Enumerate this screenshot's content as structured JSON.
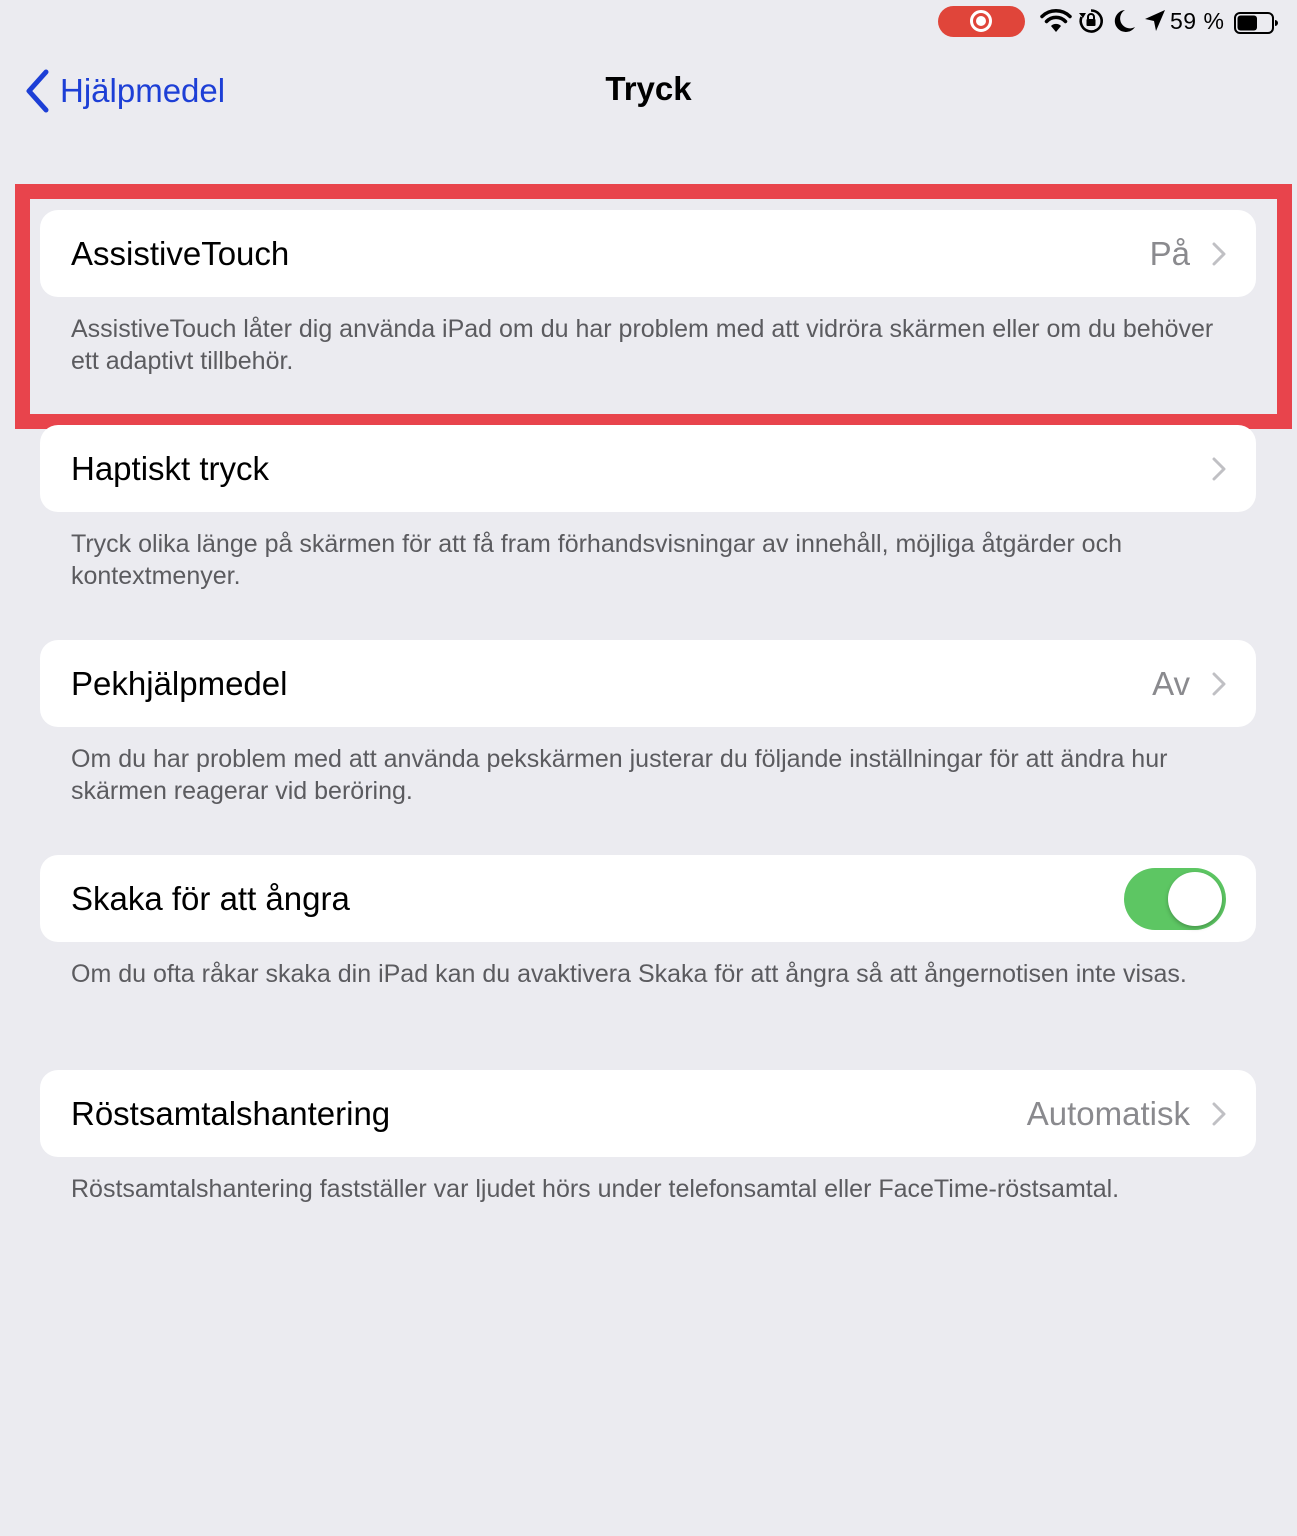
{
  "status_bar": {
    "battery_percent": "59 %",
    "battery_level": 0.59,
    "icons": [
      "screen-record-icon",
      "wifi-icon",
      "rotation-lock-icon",
      "moon-icon",
      "location-arrow-icon",
      "battery-icon"
    ],
    "record_color": "#e0453a"
  },
  "nav": {
    "back_label": "Hjälpmedel",
    "title": "Tryck",
    "accent_color": "#1d3fd6"
  },
  "rows": [
    {
      "label": "AssistiveTouch",
      "value": "På",
      "footer": "AssistiveTouch låter dig använda iPad om du har problem med att vidröra skärmen eller om du behöver ett adaptivt tillbehör."
    },
    {
      "label": "Haptiskt tryck",
      "value": "",
      "footer": "Tryck olika länge på skärmen för att få fram förhandsvisningar av innehåll, möjliga åtgärder och kontextmenyer."
    },
    {
      "label": "Pekhjälpmedel",
      "value": "Av",
      "footer": "Om du har problem med att använda pekskärmen justerar du följande inställningar för att ändra hur skärmen reagerar vid beröring."
    },
    {
      "label": "Skaka för att ångra",
      "toggle_on": true,
      "footer": "Om du ofta råkar skaka din iPad kan du avaktivera Skaka för att ångra så att ångernotisen inte visas."
    },
    {
      "label": "Röstsamtalshantering",
      "value": "Automatisk",
      "footer": "Röstsamtalshantering fastställer var ljudet hörs under telefonsamtal eller FaceTime-röstsamtal."
    }
  ],
  "highlight_color": "#e8444c",
  "toggle_color": "#5dc663"
}
